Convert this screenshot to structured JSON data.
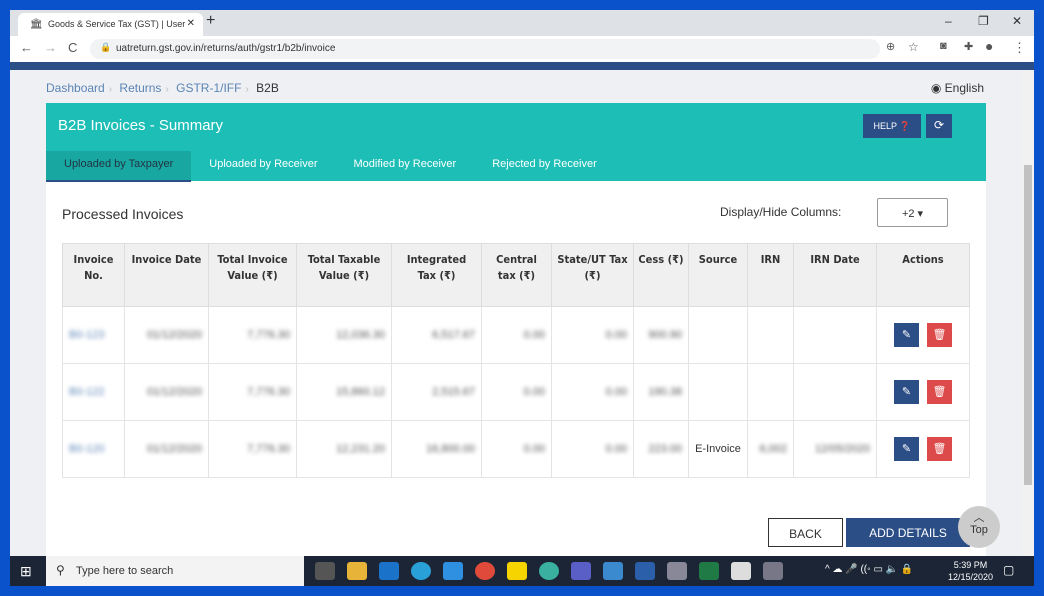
{
  "browser": {
    "tab_title": "Goods & Service Tax (GST) | User",
    "url": "uatreturn.gst.gov.in/returns/auth/gstr1/b2b/invoice"
  },
  "breadcrumb": [
    "Dashboard",
    "Returns",
    "GSTR-1/IFF",
    "B2B"
  ],
  "language": "English",
  "header": {
    "title": "B2B Invoices - Summary",
    "help_label": "HELP",
    "refresh_icon": "refresh-icon"
  },
  "tabs": [
    "Uploaded by Taxpayer",
    "Uploaded by Receiver",
    "Modified by Receiver",
    "Rejected by Receiver"
  ],
  "section_title": "Processed Invoices",
  "display_hide_label": "Display/Hide Columns:",
  "display_hide_value": "+2 ▾",
  "columns": [
    "Invoice No.",
    "Invoice Date",
    "Total Invoice Value (₹)",
    "Total Taxable Value (₹)",
    "Integrated Tax (₹)",
    "Central tax (₹)",
    "State/UT Tax (₹)",
    "Cess (₹)",
    "Source",
    "IRN",
    "IRN Date",
    "Actions"
  ],
  "rows": [
    {
      "inv": "B0-123",
      "date": "01/12/2020",
      "tiv": "7,776.30",
      "ttv": "12,036.30",
      "igst": "6,517.67",
      "cgst": "0.00",
      "sgst": "0.00",
      "cess": "900.90",
      "source": "",
      "irn": "",
      "irn_date": ""
    },
    {
      "inv": "B0-122",
      "date": "01/12/2020",
      "tiv": "7,776.30",
      "ttv": "15,860.12",
      "igst": "2,515.67",
      "cgst": "0.00",
      "sgst": "0.00",
      "cess": "190.38",
      "source": "",
      "irn": "",
      "irn_date": ""
    },
    {
      "inv": "B0-120",
      "date": "01/12/2020",
      "tiv": "7,776.30",
      "ttv": "12,231.20",
      "igst": "16,800.00",
      "cgst": "0.00",
      "sgst": "0.00",
      "cess": "223.00",
      "source": "E-Invoice",
      "irn": "6,002",
      "irn_date": "12/05/2020"
    }
  ],
  "buttons": {
    "back": "BACK",
    "add": "ADD DETAILS",
    "top": "Top"
  },
  "taskbar": {
    "search_placeholder": "Type here to search",
    "time": "5:39 PM",
    "date": "12/15/2020"
  }
}
